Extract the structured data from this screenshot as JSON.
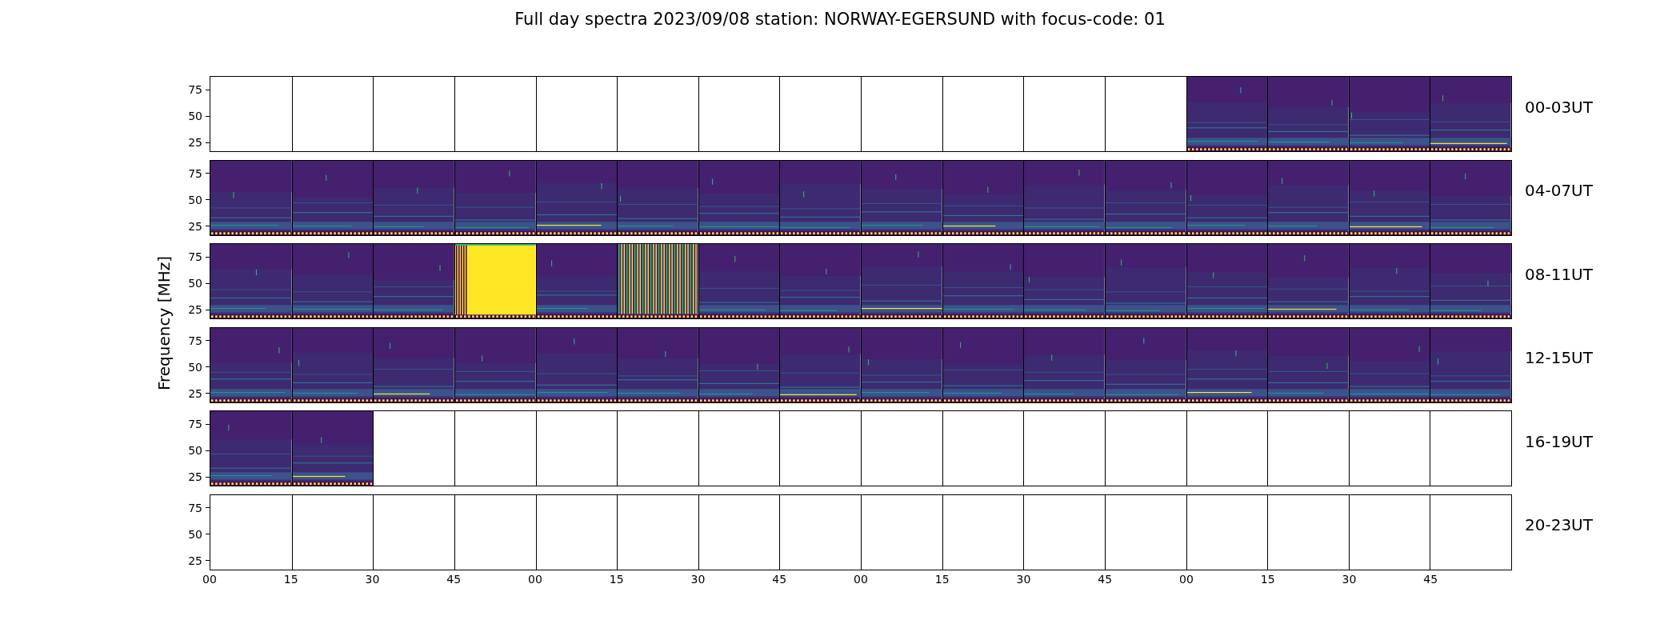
{
  "title": "Full day spectra 2023/09/08 station: NORWAY-EGERSUND with focus-code: 01",
  "y_axis_label": "Frequency [MHz]",
  "rows": [
    {
      "label": "00-03UT",
      "yticks": [
        "75",
        "50",
        "25"
      ],
      "cells": [
        {
          "kind": "empty"
        },
        {
          "kind": "empty"
        },
        {
          "kind": "empty"
        },
        {
          "kind": "empty"
        },
        {
          "kind": "empty"
        },
        {
          "kind": "empty"
        },
        {
          "kind": "empty"
        },
        {
          "kind": "empty"
        },
        {
          "kind": "empty"
        },
        {
          "kind": "empty"
        },
        {
          "kind": "empty"
        },
        {
          "kind": "empty"
        },
        {
          "kind": "spectrum"
        },
        {
          "kind": "spectrum"
        },
        {
          "kind": "spectrum"
        },
        {
          "kind": "spectrum"
        }
      ]
    },
    {
      "label": "04-07UT",
      "yticks": [
        "75",
        "50",
        "25"
      ],
      "cells": [
        {
          "kind": "spectrum"
        },
        {
          "kind": "spectrum"
        },
        {
          "kind": "spectrum"
        },
        {
          "kind": "spectrum"
        },
        {
          "kind": "spectrum"
        },
        {
          "kind": "spectrum"
        },
        {
          "kind": "spectrum"
        },
        {
          "kind": "spectrum"
        },
        {
          "kind": "spectrum"
        },
        {
          "kind": "spectrum"
        },
        {
          "kind": "spectrum"
        },
        {
          "kind": "spectrum"
        },
        {
          "kind": "spectrum"
        },
        {
          "kind": "spectrum"
        },
        {
          "kind": "spectrum"
        },
        {
          "kind": "spectrum"
        }
      ]
    },
    {
      "label": "08-11UT",
      "yticks": [
        "75",
        "50",
        "25"
      ],
      "cells": [
        {
          "kind": "spectrum"
        },
        {
          "kind": "spectrum"
        },
        {
          "kind": "spectrum"
        },
        {
          "kind": "saturated"
        },
        {
          "kind": "spectrum"
        },
        {
          "kind": "striped"
        },
        {
          "kind": "spectrum"
        },
        {
          "kind": "spectrum"
        },
        {
          "kind": "spectrum"
        },
        {
          "kind": "spectrum"
        },
        {
          "kind": "spectrum"
        },
        {
          "kind": "spectrum"
        },
        {
          "kind": "spectrum"
        },
        {
          "kind": "spectrum"
        },
        {
          "kind": "spectrum"
        },
        {
          "kind": "spectrum"
        }
      ]
    },
    {
      "label": "12-15UT",
      "yticks": [
        "75",
        "50",
        "25"
      ],
      "cells": [
        {
          "kind": "spectrum"
        },
        {
          "kind": "spectrum"
        },
        {
          "kind": "spectrum"
        },
        {
          "kind": "spectrum"
        },
        {
          "kind": "spectrum"
        },
        {
          "kind": "spectrum"
        },
        {
          "kind": "spectrum"
        },
        {
          "kind": "spectrum"
        },
        {
          "kind": "spectrum"
        },
        {
          "kind": "spectrum"
        },
        {
          "kind": "spectrum"
        },
        {
          "kind": "spectrum"
        },
        {
          "kind": "spectrum"
        },
        {
          "kind": "spectrum"
        },
        {
          "kind": "spectrum"
        },
        {
          "kind": "spectrum"
        }
      ]
    },
    {
      "label": "16-19UT",
      "yticks": [
        "75",
        "50",
        "25"
      ],
      "cells": [
        {
          "kind": "spectrum"
        },
        {
          "kind": "spectrum"
        },
        {
          "kind": "empty"
        },
        {
          "kind": "empty"
        },
        {
          "kind": "empty"
        },
        {
          "kind": "empty"
        },
        {
          "kind": "empty"
        },
        {
          "kind": "empty"
        },
        {
          "kind": "empty"
        },
        {
          "kind": "empty"
        },
        {
          "kind": "empty"
        },
        {
          "kind": "empty"
        },
        {
          "kind": "empty"
        },
        {
          "kind": "empty"
        },
        {
          "kind": "empty"
        },
        {
          "kind": "empty"
        }
      ]
    },
    {
      "label": "20-23UT",
      "yticks": [
        "75",
        "50",
        "25"
      ],
      "cells": [
        {
          "kind": "empty"
        },
        {
          "kind": "empty"
        },
        {
          "kind": "empty"
        },
        {
          "kind": "empty"
        },
        {
          "kind": "empty"
        },
        {
          "kind": "empty"
        },
        {
          "kind": "empty"
        },
        {
          "kind": "empty"
        },
        {
          "kind": "empty"
        },
        {
          "kind": "empty"
        },
        {
          "kind": "empty"
        },
        {
          "kind": "empty"
        },
        {
          "kind": "empty"
        },
        {
          "kind": "empty"
        },
        {
          "kind": "empty"
        },
        {
          "kind": "empty"
        }
      ]
    }
  ],
  "x_ticks": [
    "00",
    "15",
    "30",
    "45",
    "00",
    "15",
    "30",
    "45",
    "00",
    "15",
    "30",
    "45",
    "00",
    "15",
    "30",
    "45"
  ]
}
